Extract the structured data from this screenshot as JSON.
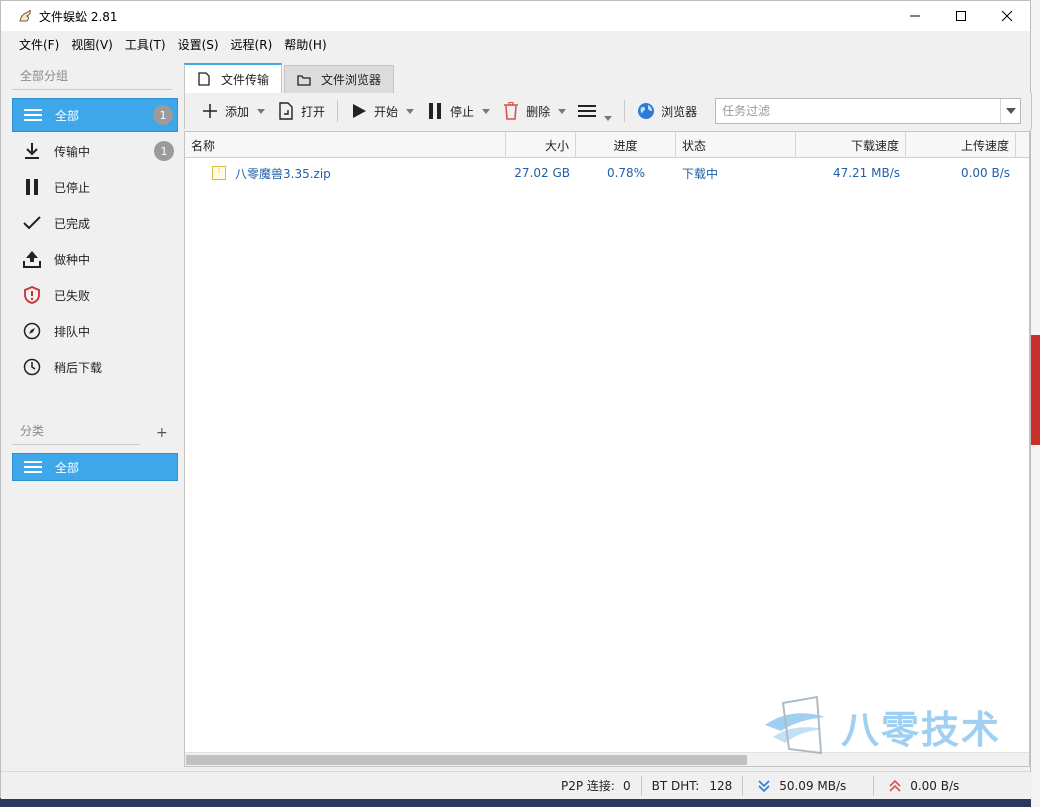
{
  "window": {
    "title": "文件蜈蚣 2.81"
  },
  "menu": [
    "文件(F)",
    "视图(V)",
    "工具(T)",
    "设置(S)",
    "远程(R)",
    "帮助(H)"
  ],
  "sidebar": {
    "group_heading": "全部分组",
    "items": [
      {
        "label": "全部",
        "icon": "list-icon",
        "badge": "1",
        "active": true
      },
      {
        "label": "传输中",
        "icon": "download-icon",
        "badge": "1",
        "active": false
      },
      {
        "label": "已停止",
        "icon": "pause-icon",
        "badge": null,
        "active": false
      },
      {
        "label": "已完成",
        "icon": "check-icon",
        "badge": null,
        "active": false
      },
      {
        "label": "做种中",
        "icon": "upload-icon",
        "badge": null,
        "active": false
      },
      {
        "label": "已失败",
        "icon": "shield-alert-icon",
        "badge": null,
        "active": false
      },
      {
        "label": "排队中",
        "icon": "compass-icon",
        "badge": null,
        "active": false
      },
      {
        "label": "稍后下载",
        "icon": "clock-icon",
        "badge": null,
        "active": false
      }
    ],
    "category_heading": "分类",
    "category_add": "+",
    "categories": [
      {
        "label": "全部",
        "icon": "list-icon",
        "active": true
      }
    ]
  },
  "tabs": [
    {
      "label": "文件传输",
      "icon": "file-icon",
      "active": true
    },
    {
      "label": "文件浏览器",
      "icon": "folder-icon",
      "active": false
    }
  ],
  "toolbar": {
    "add": "添加",
    "open": "打开",
    "start": "开始",
    "stop": "停止",
    "delete": "删除",
    "browser": "浏览器",
    "filter_placeholder": "任务过滤"
  },
  "table": {
    "columns": [
      "名称",
      "大小",
      "进度",
      "状态",
      "下载速度",
      "上传速度"
    ],
    "rows": [
      {
        "name": "八零魔兽3.35.zip",
        "size": "27.02 GB",
        "progress": "0.78%",
        "status": "下载中",
        "down": "47.21 MB/s",
        "up": "0.00 B/s"
      }
    ]
  },
  "status": {
    "p2p_label": "P2P 连接:",
    "p2p_value": "0",
    "dht_label": "BT DHT:",
    "dht_value": "128",
    "down_speed": "50.09 MB/s",
    "up_speed": "0.00 B/s"
  },
  "watermark": "八零技术",
  "colors": {
    "accent": "#3da7ea",
    "link": "#1f5fa6",
    "badge": "#9b9b9b",
    "delete": "#d9534f"
  }
}
